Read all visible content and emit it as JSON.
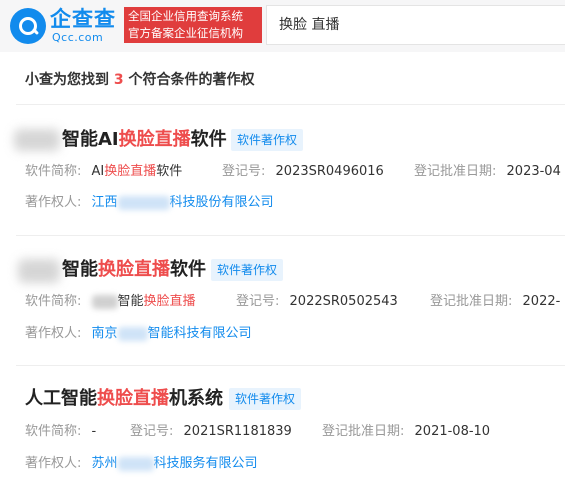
{
  "header": {
    "logo_name": "企查查",
    "logo_domain": "Qcc.com",
    "slogan_line1": "全国企业信用查询系统",
    "slogan_line2": "官方备案企业征信机构",
    "search_value": "换脸 直播"
  },
  "summary": {
    "prefix": "小查为您找到",
    "count": "3",
    "suffix": "个符合条件的著作权"
  },
  "results": [
    {
      "title_pre": "智能AI",
      "title_hl": "换脸直播",
      "title_post": "软件",
      "tag": "软件著作权",
      "short_name_label": "软件简称:",
      "short_name_pre": "AI",
      "short_name_hl": "换脸直播",
      "short_name_post": "软件",
      "reg_no_label": "登记号:",
      "reg_no": "2023SR0496016",
      "approval_label": "登记批准日期:",
      "approval_date": "2023-04",
      "owner_label": "著作权人:",
      "owner_pre": "江西",
      "owner_post": "科技股份有限公司"
    },
    {
      "title_pre": "智能",
      "title_hl": "换脸直播",
      "title_post": "软件",
      "tag": "软件著作权",
      "short_name_label": "软件简称:",
      "short_name_pre": "智能",
      "short_name_hl": "换脸直播",
      "reg_no_label": "登记号:",
      "reg_no": "2022SR0502543",
      "approval_label": "登记批准日期:",
      "approval_date": "2022-",
      "owner_label": "著作权人:",
      "owner_pre": "南京",
      "owner_post": "智能科技有限公司"
    },
    {
      "title_pre": "人工智能",
      "title_hl": "换脸直播",
      "title_post": "机系统",
      "tag": "软件著作权",
      "short_name_label": "软件简称:",
      "short_name": "-",
      "reg_no_label": "登记号:",
      "reg_no": "2021SR1181839",
      "approval_label": "登记批准日期:",
      "approval_date": "2021-08-10",
      "owner_label": "著作权人:",
      "owner_pre": "苏州",
      "owner_post": "科技服务有限公司"
    }
  ]
}
